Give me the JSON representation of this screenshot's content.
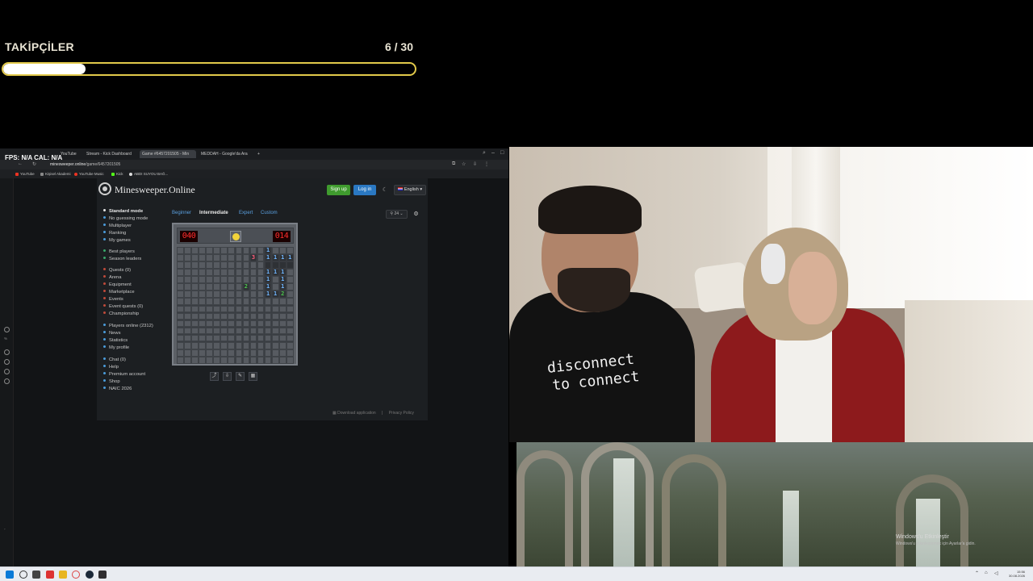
{
  "overlay": {
    "goal_title": "TAKİPÇİLER",
    "goal_current": "6",
    "goal_sep": " / ",
    "goal_total": "30",
    "goal_progress": 0.2
  },
  "browser": {
    "fps_label": "FPS: N/A  CAL: N/A",
    "tabs": [
      "",
      "YouTube",
      "Stream - Kick Dashboard",
      "Game #6457201505 - Min",
      "MEDDAH - Google'da Ara"
    ],
    "new_tab": "+",
    "url_domain": "minesweeper.online",
    "url_path": "/game/6457201505",
    "bookmarks": [
      "YouTube",
      "Kişisel Akademi",
      "YouTube Music",
      "Kick",
      "ABDI SUYOU BAĞ..."
    ]
  },
  "site": {
    "logo": "Minesweeper.Online",
    "signup": "Sign up",
    "login": "Log in",
    "dark_toggle": "☾",
    "language": "English ▾",
    "menu": [
      {
        "label": "Standard mode",
        "bold": true,
        "color": "#e8e8e8"
      },
      {
        "label": "No guessing mode",
        "bold": false,
        "color": "#4a9cdb"
      },
      {
        "label": "Multiplayer",
        "bold": false,
        "color": "#4a9cdb"
      },
      {
        "label": "Ranking",
        "bold": false,
        "color": "#4a9cdb"
      },
      {
        "label": "My games",
        "bold": false,
        "color": "#4a9cdb"
      },
      {
        "label": "Best players",
        "bold": false,
        "color": "#3aa86b"
      },
      {
        "label": "Season leaders",
        "bold": false,
        "color": "#3aa86b"
      },
      {
        "label": "Quests (0)",
        "bold": false,
        "color": "#c04a3a"
      },
      {
        "label": "Arena",
        "bold": false,
        "color": "#c04a3a"
      },
      {
        "label": "Equipment",
        "bold": false,
        "color": "#c04a3a"
      },
      {
        "label": "Marketplace",
        "bold": false,
        "color": "#c04a3a"
      },
      {
        "label": "Events",
        "bold": false,
        "color": "#c04a3a"
      },
      {
        "label": "Event quests (0)",
        "bold": false,
        "color": "#c04a3a"
      },
      {
        "label": "Championship",
        "bold": false,
        "color": "#c04a3a"
      },
      {
        "label": "Players online (2312)",
        "bold": false,
        "color": "#4a9cdb"
      },
      {
        "label": "News",
        "bold": false,
        "color": "#4a9cdb"
      },
      {
        "label": "Statistics",
        "bold": false,
        "color": "#4a9cdb"
      },
      {
        "label": "My profile",
        "bold": false,
        "color": "#4a9cdb"
      },
      {
        "label": "Chat (0)",
        "bold": false,
        "color": "#4a9cdb"
      },
      {
        "label": "Help",
        "bold": false,
        "color": "#4a9cdb"
      },
      {
        "label": "Premium account",
        "bold": false,
        "color": "#4a9cdb"
      },
      {
        "label": "Shop",
        "bold": false,
        "color": "#4a9cdb"
      },
      {
        "label": "NAIC 2026",
        "bold": false,
        "color": "#4a9cdb"
      }
    ],
    "difficulty_tabs": [
      {
        "label": "Beginner",
        "active": false
      },
      {
        "label": "Intermediate",
        "active": true
      },
      {
        "label": "Expert",
        "active": false
      },
      {
        "label": "Custom",
        "active": false
      }
    ],
    "zoom_label": "24",
    "settings_icon": "⚙",
    "footer_download": "Download application",
    "footer_sep": "|",
    "footer_privacy": "Privacy Policy"
  },
  "game": {
    "mines_left": "040",
    "timer": "014",
    "rows": 16,
    "cols": 16,
    "open_cells": [
      {
        "r": 0,
        "c": 12,
        "v": "1"
      },
      {
        "r": 1,
        "c": 10,
        "v": "3"
      },
      {
        "r": 1,
        "c": 12,
        "v": "1"
      },
      {
        "r": 1,
        "c": 13,
        "v": "1"
      },
      {
        "r": 1,
        "c": 14,
        "v": "1"
      },
      {
        "r": 1,
        "c": 15,
        "v": "1"
      },
      {
        "r": 2,
        "c": 12,
        "v": ""
      },
      {
        "r": 2,
        "c": 13,
        "v": ""
      },
      {
        "r": 2,
        "c": 14,
        "v": ""
      },
      {
        "r": 2,
        "c": 15,
        "v": ""
      },
      {
        "r": 3,
        "c": 12,
        "v": "1"
      },
      {
        "r": 3,
        "c": 13,
        "v": "1"
      },
      {
        "r": 3,
        "c": 14,
        "v": "1"
      },
      {
        "r": 4,
        "c": 12,
        "v": "1"
      },
      {
        "r": 4,
        "c": 14,
        "v": "1"
      },
      {
        "r": 5,
        "c": 9,
        "v": "2"
      },
      {
        "r": 5,
        "c": 12,
        "v": "1"
      },
      {
        "r": 5,
        "c": 14,
        "v": "1"
      },
      {
        "r": 6,
        "c": 12,
        "v": "1"
      },
      {
        "r": 6,
        "c": 13,
        "v": "1"
      },
      {
        "r": 6,
        "c": 14,
        "v": "2"
      }
    ],
    "number_colors": {
      "1": "#6fb6ff",
      "2": "#4ecb4e",
      "3": "#ff5c7a"
    },
    "tools": [
      "⤴",
      "⇩",
      "✎",
      "▦"
    ]
  },
  "webcam": {
    "shirt_line1": "disconnect",
    "shirt_line2": "to connect"
  },
  "desktop": {
    "activate_title": "Windows'u Etkinleştir",
    "activate_sub": "Windows'u etkinleştirmek için Ayarlar'a gidin.",
    "clock_time": "15:56",
    "clock_date": "30.08.2026"
  }
}
